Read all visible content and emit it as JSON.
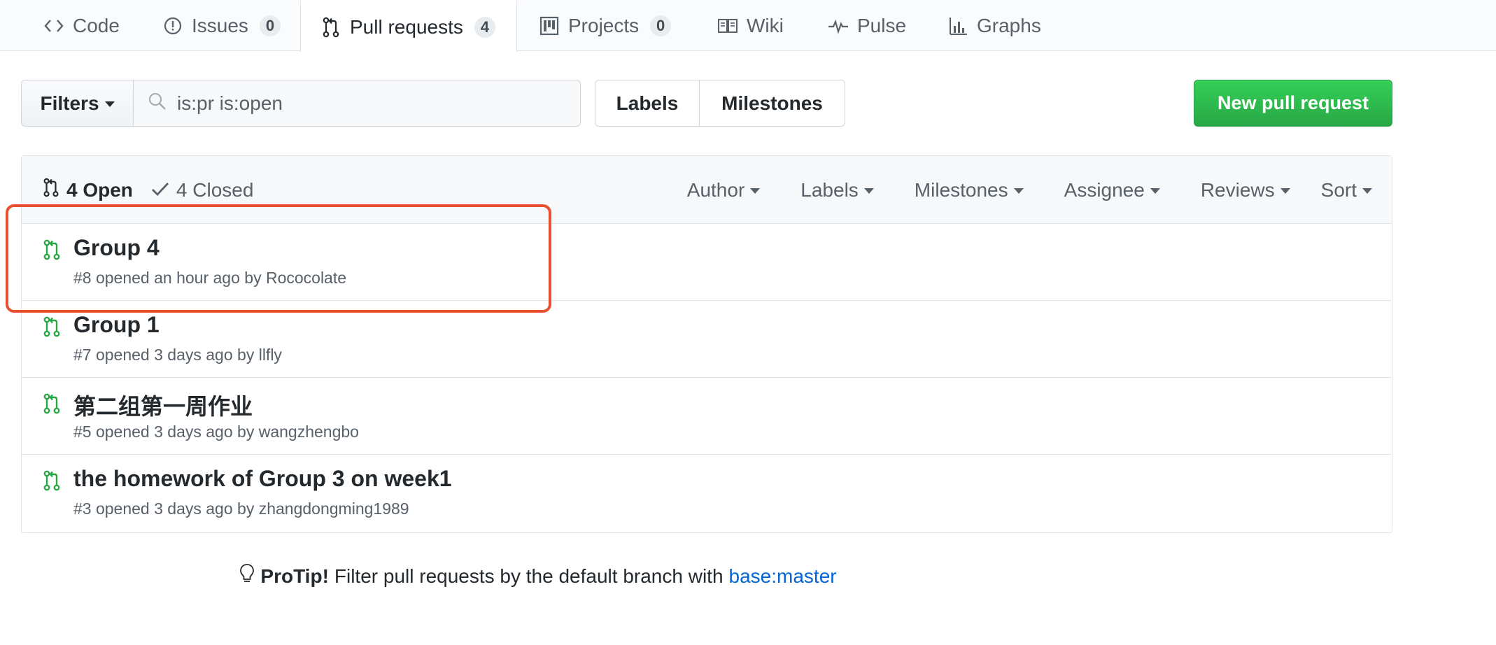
{
  "nav": {
    "tabs": [
      {
        "label": "Code",
        "icon": "code-icon"
      },
      {
        "label": "Issues",
        "icon": "issue-opened-icon",
        "counter": "0"
      },
      {
        "label": "Pull requests",
        "icon": "git-pull-request-icon",
        "counter": "4",
        "selected": true
      },
      {
        "label": "Projects",
        "icon": "project-icon",
        "counter": "0"
      },
      {
        "label": "Wiki",
        "icon": "book-icon"
      },
      {
        "label": "Pulse",
        "icon": "pulse-icon"
      },
      {
        "label": "Graphs",
        "icon": "graph-icon"
      }
    ]
  },
  "subnav": {
    "filters_label": "Filters",
    "search_value": "is:pr is:open",
    "labels_label": "Labels",
    "milestones_label": "Milestones",
    "new_pr_label": "New pull request"
  },
  "list_header": {
    "open_label": "4 Open",
    "closed_label": "4 Closed",
    "sorters": [
      "Author",
      "Labels",
      "Milestones",
      "Assignee",
      "Reviews",
      "Sort"
    ]
  },
  "pull_requests": [
    {
      "title": "Group 4",
      "meta": "#8 opened an hour ago by Rococolate"
    },
    {
      "title": "Group 1",
      "meta": "#7 opened 3 days ago by llfly"
    },
    {
      "title": "第二组第一周作业",
      "meta": "#5 opened 3 days ago by wangzhengbo"
    },
    {
      "title": "the homework of Group 3 on week1",
      "meta": "#3 opened 3 days ago by zhangdongming1989"
    }
  ],
  "protip": {
    "strong": "ProTip!",
    "text": "Filter pull requests by the default branch with",
    "link": "base:master"
  },
  "colors": {
    "accent_green": "#28a745",
    "link_blue": "#0366d6",
    "highlight_red": "#e8502f"
  }
}
